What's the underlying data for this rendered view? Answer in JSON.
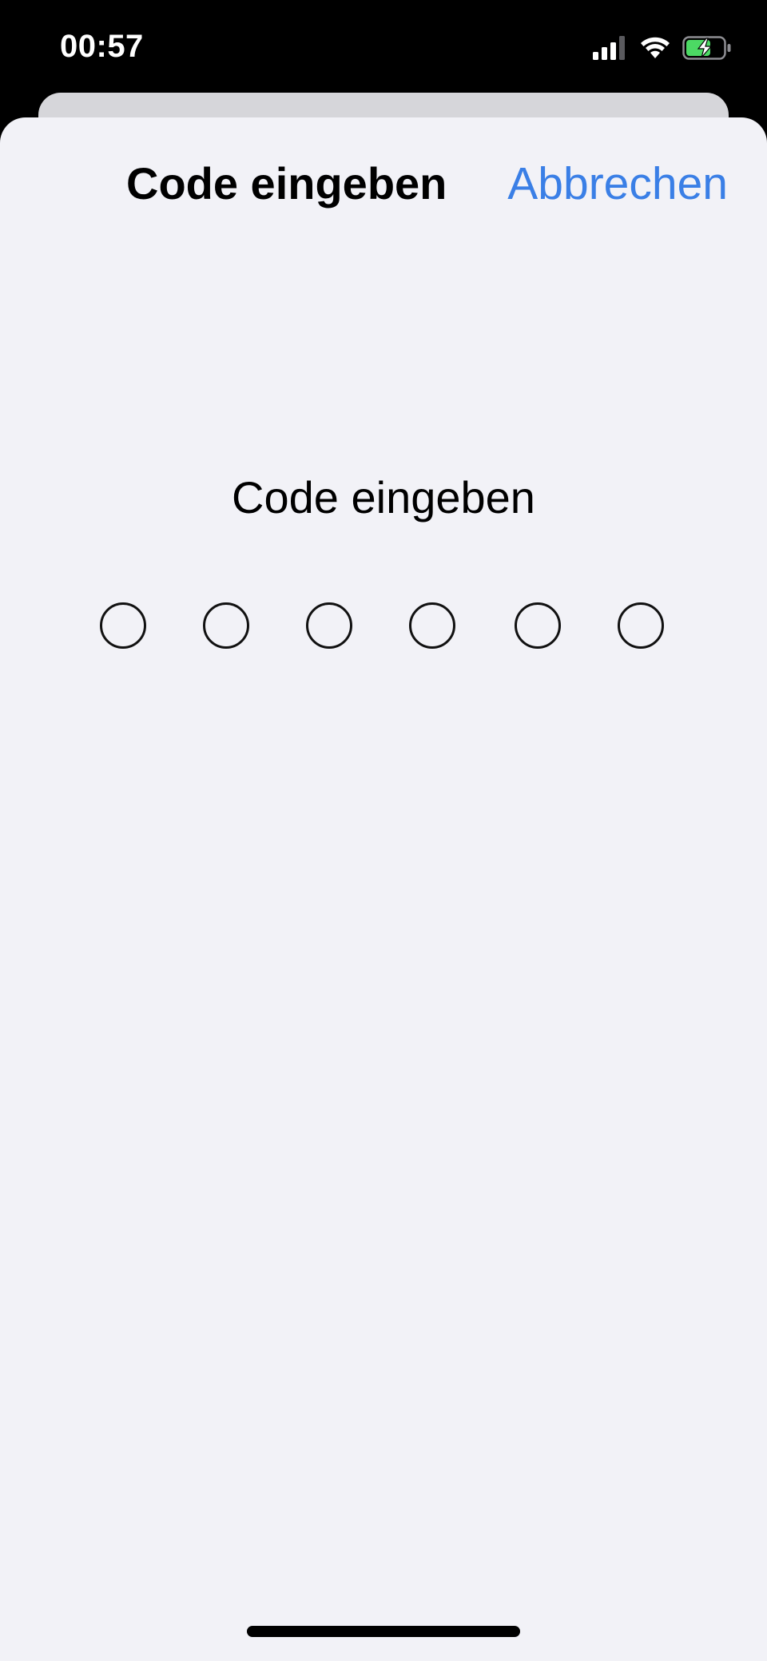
{
  "status_bar": {
    "time": "00:57",
    "icons": [
      "cellular-signal-icon",
      "wifi-icon",
      "battery-charging-icon"
    ],
    "battery_color": "#4cd964"
  },
  "sheet": {
    "title": "Code eingeben",
    "cancel_label": "Abbrechen",
    "accent_color": "#3a7fe6"
  },
  "code_entry": {
    "prompt": "Code eingeben",
    "digit_count": 6,
    "filled_count": 0
  }
}
